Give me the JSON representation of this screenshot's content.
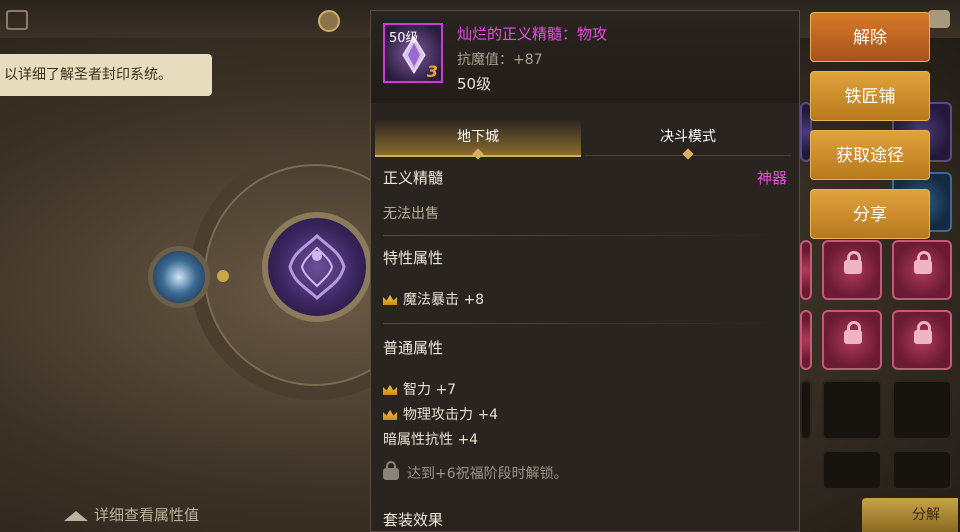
{
  "background": {
    "hint_text": "以详细了解圣者封印系统。",
    "detail_link_label": "详细查看属性值",
    "decompose_label": "分解"
  },
  "tooltip": {
    "item_level_badge": "50级",
    "item_tier": "3",
    "item_name": "灿烂的正义精髓：物攻",
    "magic_resist": "抗魔值：+87",
    "item_level": "50级",
    "tabs": [
      {
        "label": "地下城",
        "active": true
      },
      {
        "label": "决斗模式",
        "active": false
      }
    ],
    "category": "正义精髓",
    "rarity": "神器",
    "sell_status": "无法出售",
    "trait_header": "特性属性",
    "trait_attrs": [
      {
        "label": "魔法暴击 +8",
        "crown": true
      }
    ],
    "normal_header": "普通属性",
    "normal_attrs": [
      {
        "label": "智力 +7",
        "crown": true
      },
      {
        "label": "物理攻击力 +4",
        "crown": true
      },
      {
        "label": "暗属性抗性 +4",
        "crown": false
      }
    ],
    "lock_note": "达到+6祝福阶段时解锁。",
    "set_header": "套装效果"
  },
  "actions": [
    {
      "label": "解除"
    },
    {
      "label": "铁匠铺"
    },
    {
      "label": "获取途径"
    },
    {
      "label": "分享"
    }
  ],
  "colors": {
    "rarity": "#e84ee0",
    "item_name": "#e84ee0",
    "button": "#d09a36",
    "accent_gold": "#d7b061"
  },
  "icons": {
    "menu": "menu-icon",
    "coin": "coin-icon",
    "chat": "chat-icon",
    "crown": "crown-icon",
    "lock": "lock-icon"
  }
}
